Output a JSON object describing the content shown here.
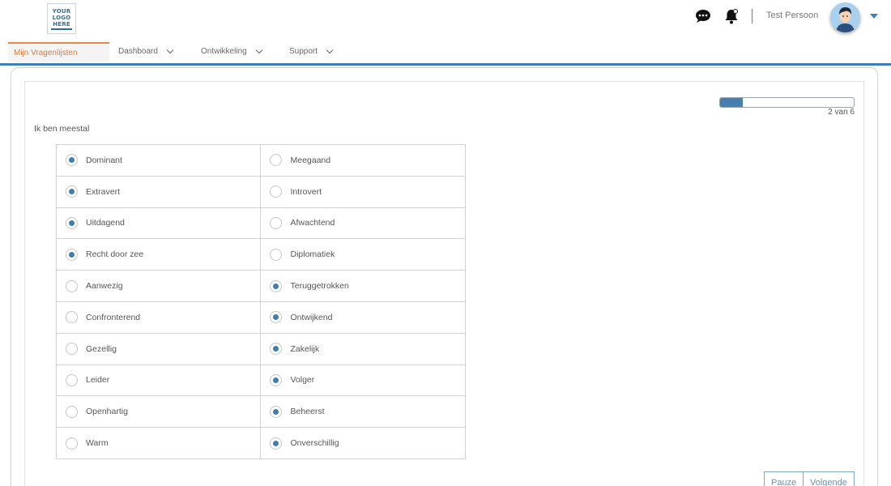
{
  "header": {
    "logo_lines": [
      "YOUR",
      "LOGO",
      "HERE"
    ],
    "user_name": "Test Persoon",
    "icons": [
      "chat-icon",
      "bell-icon",
      "user-avatar",
      "caret-down-icon"
    ]
  },
  "nav": {
    "active_tab": "Mijn Vragenlijsten",
    "items": [
      {
        "label": "Dashboard"
      },
      {
        "label": "Ontwikkeling"
      },
      {
        "label": "Support"
      }
    ]
  },
  "progress": {
    "text": "2 van 6",
    "current": 2,
    "total": 6,
    "fill_fraction": 0.17
  },
  "question": "Ik ben meestal",
  "options": [
    {
      "left": "Dominant",
      "right": "Meegaand",
      "selected": "left"
    },
    {
      "left": "Extravert",
      "right": "Introvert",
      "selected": "left"
    },
    {
      "left": "Uitdagend",
      "right": "Afwachtend",
      "selected": "left"
    },
    {
      "left": "Recht door zee",
      "right": "Diplomatiek",
      "selected": "left"
    },
    {
      "left": "Aanwezig",
      "right": "Teruggetrokken",
      "selected": "right"
    },
    {
      "left": "Confronterend",
      "right": "Ontwijkend",
      "selected": "right"
    },
    {
      "left": "Gezellig",
      "right": "Zakelijk",
      "selected": "right"
    },
    {
      "left": "Leider",
      "right": "Volger",
      "selected": "right"
    },
    {
      "left": "Openhartig",
      "right": "Beheerst",
      "selected": "right"
    },
    {
      "left": "Warm",
      "right": "Onverschillig",
      "selected": "right"
    }
  ],
  "buttons": {
    "pause": "Pauze",
    "next": "Volgende"
  },
  "colors": {
    "accent": "#3d7fb5",
    "active_tab": "#e07b35"
  }
}
